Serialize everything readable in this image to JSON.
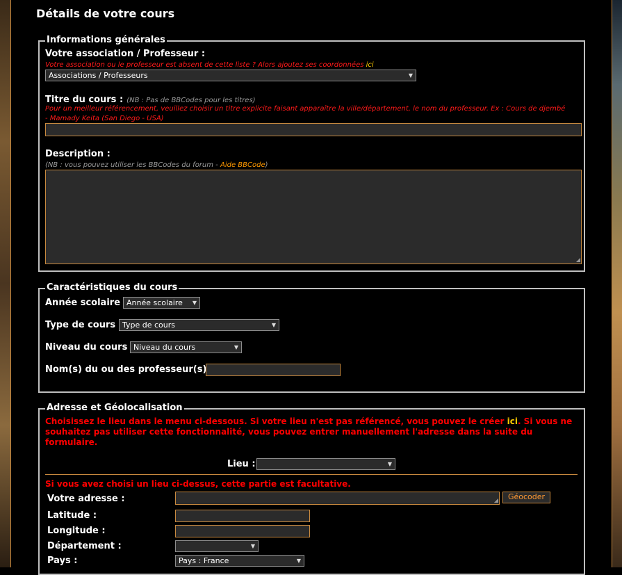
{
  "page": {
    "title": "Détails de votre cours"
  },
  "general": {
    "legend": "Informations générales",
    "association_label": "Votre association / Professeur :",
    "association_note": "Votre association ou le professeur est absent de cette liste ? Alors ajoutez ses coordonnées",
    "association_link": "ici",
    "association_select": "Associations / Professeurs",
    "title_label": "Titre du cours :",
    "title_note": "(NB : Pas de BBCodes pour les titres)",
    "title_hint_line1": "Pour un meilleur référencement, veuillez choisir un titre explicite faisant apparaître la ville/département, le nom du professeur. Ex : Cours de djembé",
    "title_hint_line2": "- Mamady Keita (San Diego - USA)",
    "description_label": "Description :",
    "description_note": "(NB : vous pouvez utiliser les BBCodes du forum -",
    "description_link": "Aide BBCode",
    "description_note_end": ")"
  },
  "characteristics": {
    "legend": "Caractéristiques du cours",
    "year_label": "Année scolaire :",
    "year_select": "Année scolaire",
    "type_label": "Type de cours :",
    "type_select": "Type de cours",
    "level_label": "Niveau du cours :",
    "level_select": "Niveau du cours",
    "teachers_label": "Nom(s) du ou des professeur(s) :"
  },
  "address": {
    "legend": "Adresse et Géolocalisation",
    "intro_line1_a": "Choisissez le lieu dans le menu ci-dessous. Si votre lieu n'est pas référencé, vous pouvez le créer",
    "intro_link": "ici",
    "intro_line1_b": ". Si vous ne",
    "intro_line2": "souhaitez pas utiliser cette fonctionnalité, vous pouvez entrer manuellement l'adresse dans la suite du",
    "intro_line3": "formulaire.",
    "place_label": "Lieu :",
    "place_select": "",
    "optional_note": "Si vous avez choisi un lieu ci-dessus, cette partie est facultative.",
    "address_label": "Votre adresse :",
    "geocode_button": "Géocoder",
    "latitude_label": "Latitude :",
    "longitude_label": "Longitude :",
    "department_label": "Département :",
    "department_select": "",
    "country_label": "Pays :",
    "country_select": "Pays : France"
  },
  "colors": {
    "accent": "#c8893e",
    "warning": "#ff0000",
    "link": "#ff9900",
    "field_bg": "#2b2b2b"
  },
  "icons": {
    "select_arrow": "triangle-down-icon",
    "resize": "resize-grip-icon"
  }
}
